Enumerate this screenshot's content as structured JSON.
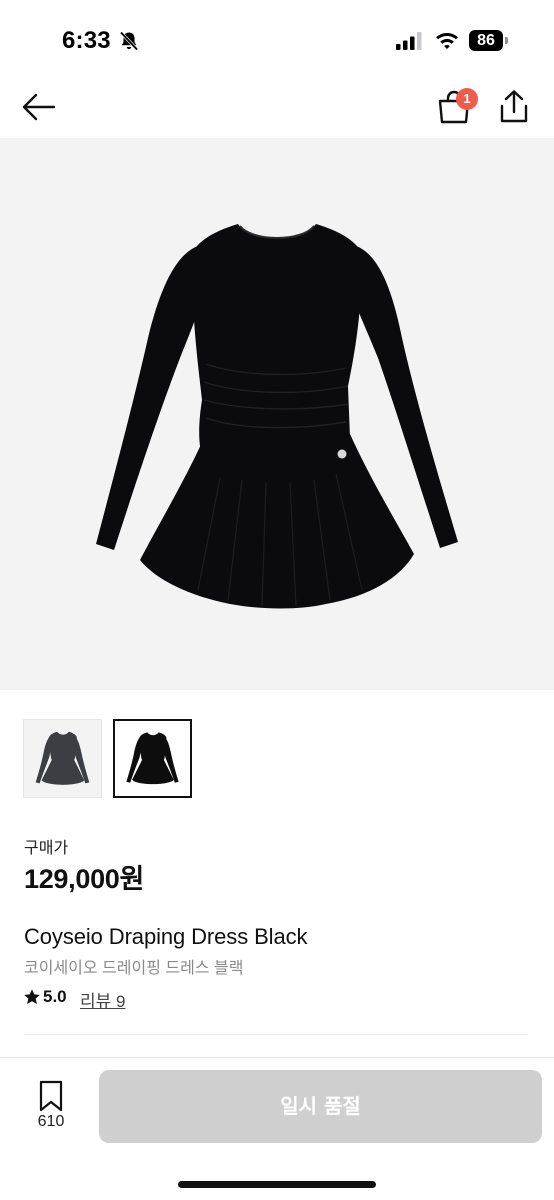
{
  "status_bar": {
    "time": "6:33",
    "battery": "86",
    "icons": [
      "bell-slash-icon",
      "cellular-signal-icon",
      "wifi-icon",
      "battery-icon"
    ]
  },
  "nav": {
    "icons": [
      "arrow-left-icon",
      "shopping-bag-icon",
      "share-icon"
    ],
    "cart_count": "1",
    "badge_color": "#f25a4c"
  },
  "gallery": {
    "thumbnails": [
      {
        "color": "#3b3f44",
        "selected": false
      },
      {
        "color": "#0d0d0d",
        "selected": true
      }
    ]
  },
  "product": {
    "price_label": "구매가",
    "price": "129,000원",
    "name": "Coyseio Draping Dress Black",
    "name_kr": "코이세이오 드레이핑 드레스 블랙",
    "rating": "5.0",
    "review_text": "리뷰 9"
  },
  "bottom_bar": {
    "bookmark_count": "610",
    "action_label": "일시 품절",
    "action_color": "#cfcfcf"
  }
}
